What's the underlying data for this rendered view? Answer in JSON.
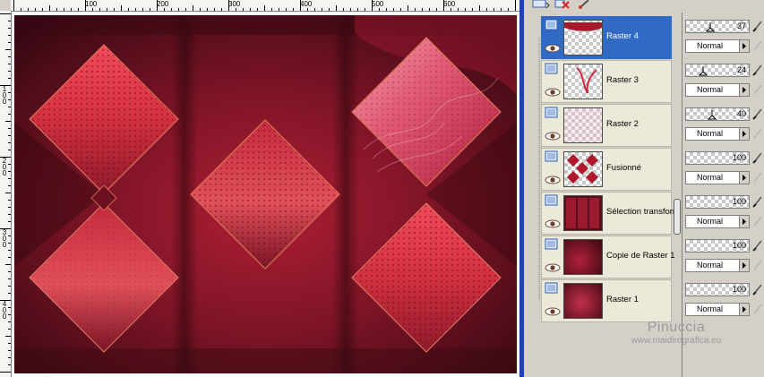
{
  "ruler_h_labels": [
    "100",
    "200",
    "300",
    "400",
    "500",
    "600"
  ],
  "ruler_v_labels": [
    "100",
    "200",
    "300",
    "400"
  ],
  "layers": [
    {
      "name": "Raster 4",
      "selected": true,
      "opacity": 37,
      "blend": "Normal"
    },
    {
      "name": "Raster 3",
      "selected": false,
      "opacity": 24,
      "blend": "Normal"
    },
    {
      "name": "Raster 2",
      "selected": false,
      "opacity": 40,
      "blend": "Normal"
    },
    {
      "name": "Fusionné",
      "selected": false,
      "opacity": 100,
      "blend": "Normal"
    },
    {
      "name": "Sélection transformée",
      "selected": false,
      "opacity": 100,
      "blend": "Normal"
    },
    {
      "name": "Copie de Raster 1",
      "selected": false,
      "opacity": 100,
      "blend": "Normal"
    },
    {
      "name": "Raster 1",
      "selected": false,
      "opacity": 100,
      "blend": "Normal"
    }
  ],
  "watermark": {
    "name": "Pinuccia",
    "url": "www.maidiregrafica.eu"
  },
  "colors": {
    "selection": "#316ac5",
    "panel": "#d4d0c8",
    "splitter": "#1f3fbf",
    "artwork_dark": "#3a0a12",
    "artwork_red": "#b5263a"
  },
  "icons": {
    "toolbar": [
      "new-layer-icon",
      "delete-layer-icon",
      "properties-icon"
    ],
    "layer_row": [
      "layer-type-icon",
      "visibility-eye-icon"
    ],
    "props": [
      "edit-brush-icon",
      "lock-icon"
    ]
  }
}
